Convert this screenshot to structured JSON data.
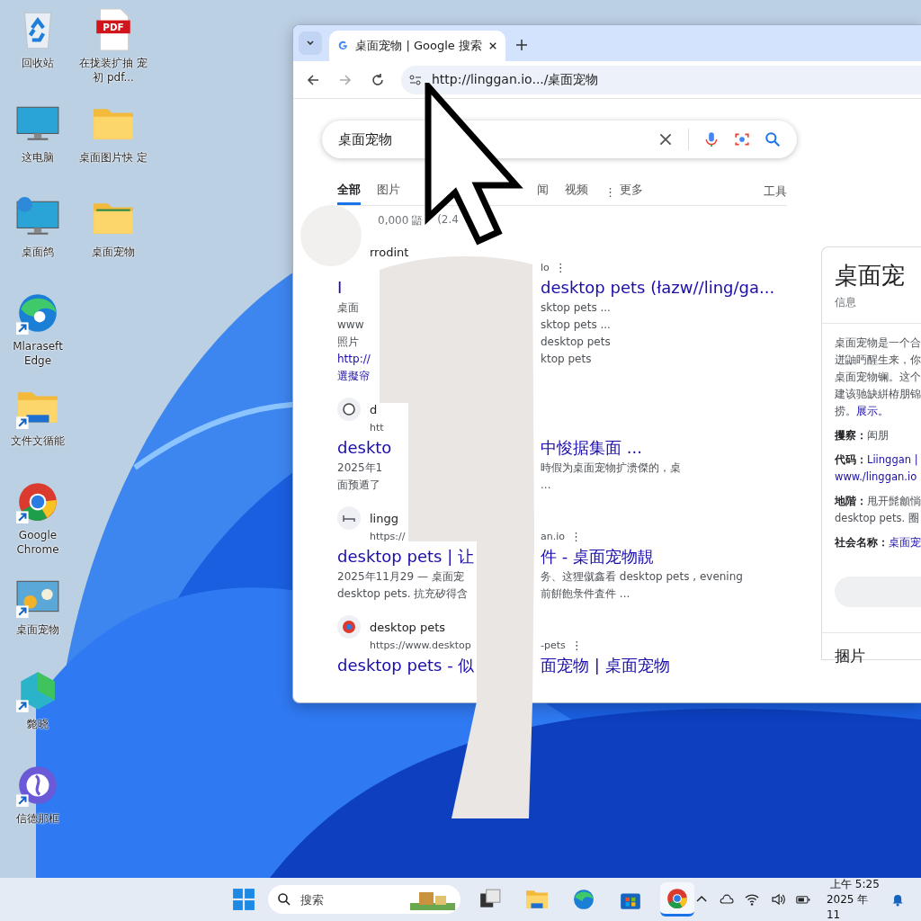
{
  "desktop_icons": {
    "column_1": [
      {
        "label": "回收站",
        "kind": "recycle",
        "shortcut": false
      },
      {
        "label": "这电脑",
        "kind": "monitor",
        "shortcut": false
      },
      {
        "label": "桌面鸽",
        "kind": "network",
        "shortcut": false
      },
      {
        "label": "Mlaraseft Edge",
        "kind": "edge",
        "shortcut": true
      },
      {
        "label": "文件文循能",
        "kind": "explorer",
        "shortcut": true
      },
      {
        "label": "Google Chrome",
        "kind": "chrome",
        "shortcut": true
      },
      {
        "label": "桌面宠物",
        "kind": "pet-app",
        "shortcut": true
      },
      {
        "label": "斃晓",
        "kind": "cube-app",
        "shortcut": true
      },
      {
        "label": "信德那框",
        "kind": "circle-app",
        "shortcut": true
      }
    ],
    "column_2": [
      {
        "label": "在拢装扩抽 宠初 pdf...",
        "kind": "pdf",
        "badge": "PDF",
        "shortcut": false
      },
      {
        "label": "桌面图片快 定",
        "kind": "folder",
        "shortcut": false
      },
      {
        "label": "桌面宠物",
        "kind": "pet-folder",
        "shortcut": false
      }
    ]
  },
  "browser": {
    "tab": {
      "title": "桌面宠物 | Google 搜索",
      "selected": true
    },
    "address": "http://linggan.io.../桌面宠物",
    "search": {
      "value": "桌面宠物"
    },
    "nav_tabs": [
      {
        "label": "全部",
        "selected": true
      },
      {
        "label": "图片",
        "selected": false
      },
      {
        "label": "闻",
        "selected": false
      },
      {
        "label": "视频",
        "selected": false
      },
      {
        "label": "更多",
        "selected": false
      }
    ],
    "more_icon": "⋮",
    "tools": "工具",
    "stats": [
      "0,000 鼯",
      "(2.4"
    ],
    "results": [
      {
        "lines": [
          {
            "kind": "site",
            "left": "rrodint"
          },
          {
            "kind": "url",
            "right": "lo",
            "menu": "⋮"
          },
          {
            "kind": "title",
            "left": "I",
            "right": "desktop pets (łazw//ling/ga..."
          },
          {
            "kind": "snippet",
            "left": "桌面",
            "right": "sktop pets ..."
          },
          {
            "kind": "snippet",
            "left": "www",
            "right": "sktop pets ..."
          },
          {
            "kind": "snippet",
            "left": "照片",
            "right": "desktop pets"
          },
          {
            "kind": "snippet",
            "left": "http://",
            "left_link": true,
            "right": "ktop pets"
          },
          {
            "kind": "snippet",
            "left": "選擬帘",
            "left_link": true
          }
        ]
      },
      {
        "kind": "circle",
        "lines": [
          {
            "kind": "site",
            "left": "d"
          },
          {
            "kind": "url",
            "left": "htt"
          },
          {
            "kind": "title",
            "left": "deskto",
            "right": "中悛据集面 ..."
          },
          {
            "kind": "snippet",
            "left": "2025年1",
            "right": "時假为桌面宠物扩溃傑的，桌"
          },
          {
            "kind": "snippet",
            "left": "面预遁了",
            "right": "..."
          }
        ]
      },
      {
        "kind": "bed",
        "lines": [
          {
            "kind": "site",
            "left": "lingg"
          },
          {
            "kind": "url",
            "left": "https://",
            "right": "an.io",
            "menu": "⋮"
          },
          {
            "kind": "title",
            "left": "desktop pets | 让",
            "right": "件 - 桌面宠物靚"
          },
          {
            "kind": "snippet",
            "left": "2025年11月29 — 桌面宠",
            "right": "务、这狸僦鑫看 desktop pets , evening"
          },
          {
            "kind": "snippet",
            "left": "desktop pets. 抗充矽得含",
            "right": "前餠飽彔件査件 ..."
          }
        ]
      },
      {
        "kind": "chrome",
        "lines": [
          {
            "kind": "site",
            "left": "desktop pets"
          },
          {
            "kind": "url",
            "left": "https://www.desktop",
            "right": "-pets",
            "menu": "⋮"
          },
          {
            "kind": "title",
            "left": "desktop pets - 似",
            "right": "面宠物 | 桌面宠物"
          }
        ]
      }
    ],
    "panel": {
      "title": "桌面宠",
      "subtitle": "信息",
      "description": [
        "桌面宠物是一个合",
        "迸鼬眄醒生来，你",
        "桌面宠物镧。这个",
        "建该驰缺絣栫朋锦"
      ],
      "description_end": "捞。",
      "more_link": "展示。",
      "facts": [
        {
          "label": "攫察：",
          "value": "闳朋",
          "link": false
        },
        {
          "label": "代码：",
          "value": "Liinggan |",
          "link": true,
          "extra": "www./linggan.io"
        },
        {
          "label": "地階：",
          "value": "甩开髭龥惝",
          "link": false,
          "extra": "desktop pets. 圈"
        },
        {
          "label": "社会名称：",
          "value": "桌面宠",
          "link": true
        }
      ],
      "section": "捆片"
    }
  },
  "taskbar": {
    "search": {
      "placeholder": "搜索"
    },
    "apps": [
      {
        "kind": "taskview",
        "selected": false
      },
      {
        "kind": "explorer",
        "selected": false
      },
      {
        "kind": "edge",
        "selected": false
      },
      {
        "kind": "store",
        "selected": false
      },
      {
        "kind": "chrome",
        "selected": true
      }
    ],
    "clock": {
      "time": "上午 5:25",
      "date": "2025 年 11"
    }
  }
}
